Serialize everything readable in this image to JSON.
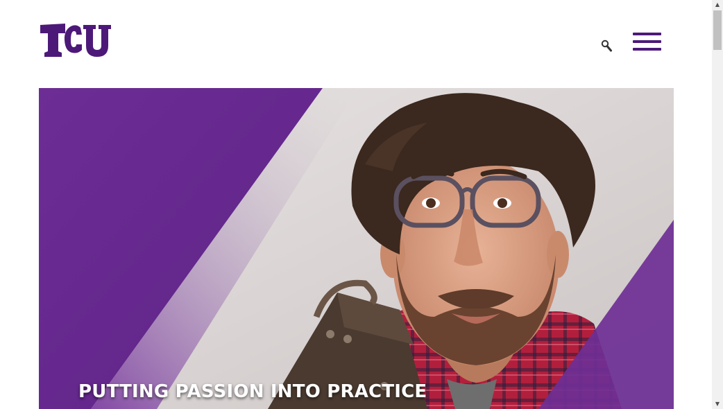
{
  "header": {
    "logo_text": "TCU",
    "search_icon": "magnifier-icon",
    "menu_icon": "hamburger-menu-icon"
  },
  "hero": {
    "title": "PUTTING PASSION INTO PRACTICE",
    "image_alt": "Bearded man wearing glasses and a red plaid shirt holding a vintage suitcase"
  },
  "scrollbar": {
    "up_arrow": "▲",
    "down_arrow": "▼"
  },
  "colors": {
    "brand_purple": "#4d1979",
    "hero_purple": "#6e2f95",
    "text_white": "#ffffff"
  }
}
